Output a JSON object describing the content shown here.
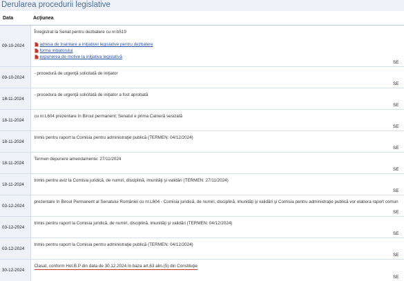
{
  "title": "Derularea procedurii legislative",
  "columns": {
    "date": "Data",
    "action": "Acţiunea"
  },
  "rows": [
    {
      "date": "09-10-2024",
      "action": "Înregistrat la Senat pentru dezbatere cu nr.b519",
      "links": [
        "adresa de înaintare a iniţiativei legislative pentru dezbatere",
        "forma iniţiatorului",
        "expunerea de motive la iniţiativa legislativă"
      ],
      "chamber": "SE"
    },
    {
      "date": "09-10-2024",
      "action": "- procedură de urgenţă solicitată de iniţiator",
      "chamber": "SE"
    },
    {
      "date": "18-11-2024",
      "action": "- procedura de urgenţă solicitată de iniţiator a fost aprobată",
      "chamber": "SE"
    },
    {
      "date": "18-11-2024",
      "action": "cu nr.L604 prezentare în Biroul permanent; Senatul e prima Cameră sesizată",
      "chamber": "SE"
    },
    {
      "date": "18-11-2024",
      "action": "trimis pentru raport la Comisia pentru administraţie publică (TERMEN: 04/12/2024)",
      "chamber": "SE"
    },
    {
      "date": "18-11-2024",
      "action": "Termen depunere amendamente: 27/11/2024",
      "chamber": "SE"
    },
    {
      "date": "18-11-2024",
      "action": "trimis pentru aviz la Comisia juridică, de numiri, disciplină, imunităţi şi validări (TERMEN: 27/11/2024)",
      "chamber": "SE"
    },
    {
      "date": "03-12-2024",
      "action": "prezentare în Biroul Permanent al Senatului României cu nr.L604 - Comisia juridică, de numiri, disciplină, imunităţi şi validări şi Comisia pentru administraţie publică vor elabora raport comun",
      "chamber": "SE"
    },
    {
      "date": "03-12-2024",
      "action": "trimis pentru raport la Comisia juridică, de numiri, disciplină, imunităţi şi validări (TERMEN: 04/12/2024)",
      "chamber": "SE"
    },
    {
      "date": "03-12-2024",
      "action": "trimis pentru raport la Comisia pentru administraţie publică (TERMEN: 04/12/2024)",
      "chamber": "SE"
    },
    {
      "date": "30-12-2024",
      "action": "Clasat, conform Hot.B.P din data de 30.12.2024 în baza art.63 alin.(5) din Constituţie",
      "chamber": "SE"
    }
  ],
  "icons": {
    "document": "pdf-icon"
  },
  "colors": {
    "title": "#4a6d9a",
    "link": "#2a4fa0",
    "date_bg": "#eef2f7",
    "underline": "#c0392b"
  }
}
